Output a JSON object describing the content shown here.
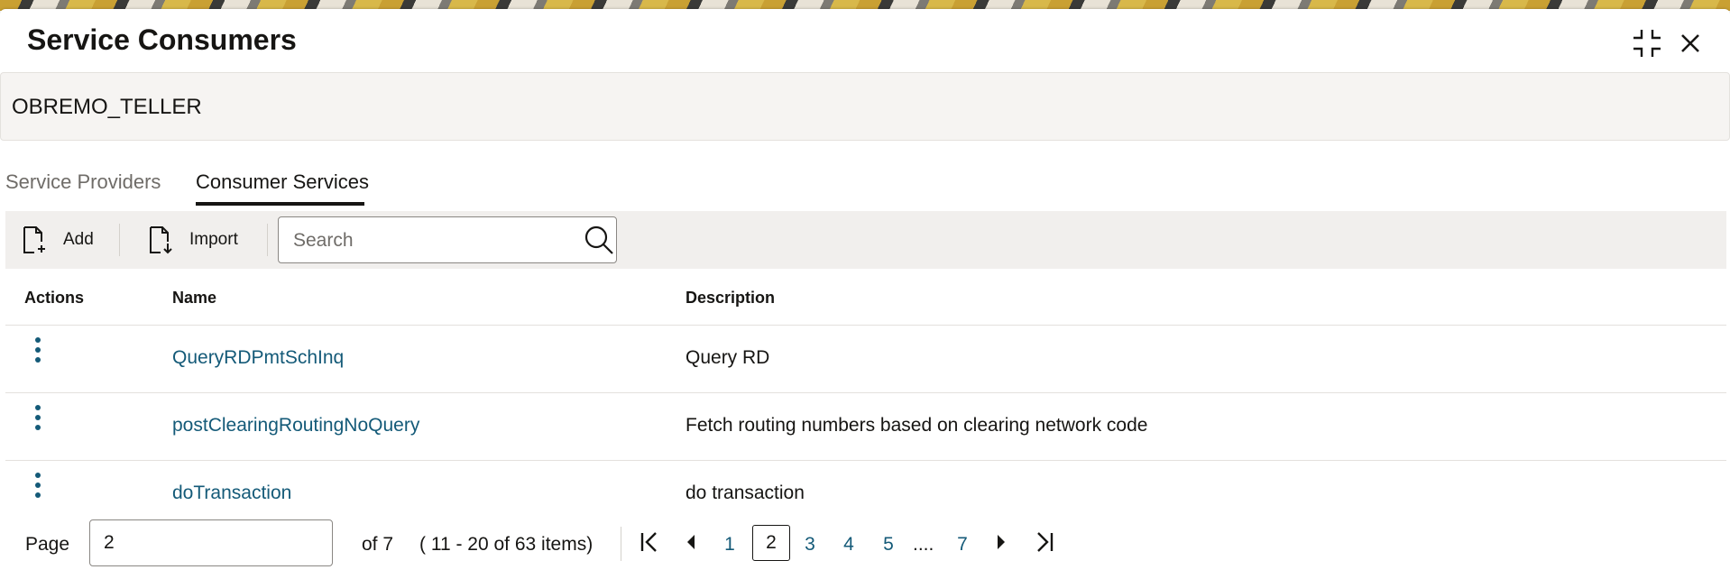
{
  "dialog": {
    "title": "Service Consumers",
    "consumer_name": "OBREMO_TELLER"
  },
  "tabs": [
    {
      "label": "Service Providers",
      "active": false
    },
    {
      "label": "Consumer Services",
      "active": true
    }
  ],
  "toolbar": {
    "add_label": "Add",
    "import_label": "Import",
    "search_placeholder": "Search"
  },
  "table": {
    "columns": [
      "Actions",
      "Name",
      "Description"
    ],
    "rows": [
      {
        "name": "QueryRDPmtSchInq",
        "description": "Query RD"
      },
      {
        "name": "postClearingRoutingNoQuery",
        "description": "Fetch routing numbers based on clearing network code"
      },
      {
        "name": "doTransaction",
        "description": "do transaction"
      }
    ]
  },
  "pagination": {
    "page_label": "Page",
    "current_page": "2",
    "of_label": "of 7",
    "range_label": "( 11 - 20 of 63 items)",
    "pages": [
      "1",
      "2",
      "3",
      "4",
      "5",
      "7"
    ],
    "ellipsis": "...."
  },
  "colors": {
    "link": "#145a78",
    "toolbar_bg": "#f1efed",
    "infobar_bg": "#f6f4f2"
  },
  "icons": [
    "compress-icon",
    "close-icon",
    "add-file-icon",
    "import-file-icon",
    "search-icon",
    "kebab-icon",
    "first-page-icon",
    "prev-page-icon",
    "next-page-icon",
    "last-page-icon"
  ]
}
